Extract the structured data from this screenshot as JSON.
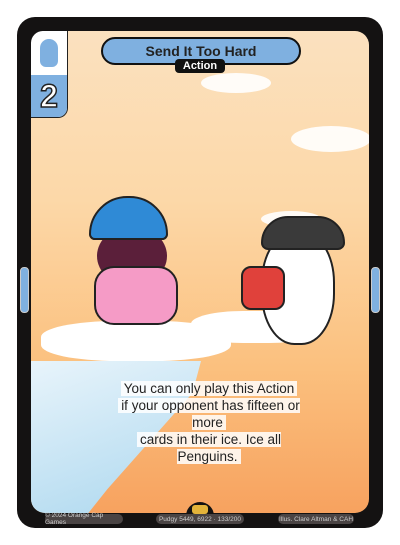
{
  "card": {
    "title": "Send It Too Hard",
    "type": "Action",
    "cost": "2",
    "cost_icon": "penguin-icon",
    "rules_text": [
      "You can only play this Action",
      "if your opponent has fifteen or more",
      "cards in their ice. Ice all Penguins."
    ]
  },
  "footer": {
    "copyright": "© 2024 Orange Cap Games",
    "set_info": "Pudgy 5449, 6922 · 133/200",
    "illustrator": "Illus. Clare Altman & CAH"
  },
  "colors": {
    "accent": "#7fb0e0",
    "frame": "#141212"
  }
}
